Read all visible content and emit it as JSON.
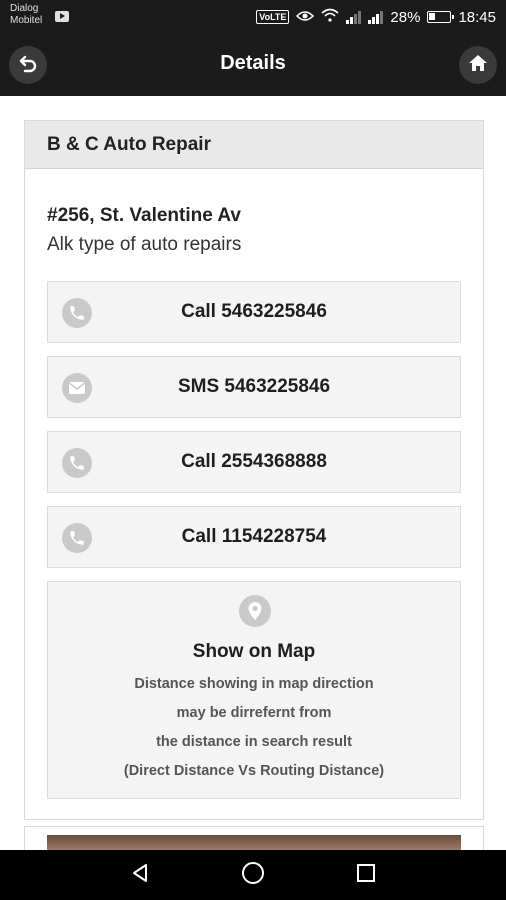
{
  "status_bar": {
    "carrier_line1": "Dialog",
    "carrier_line2": "Mobitel",
    "network_badge": "VoLTE",
    "battery": "28%",
    "time": "18:45"
  },
  "app_bar": {
    "title": "Details",
    "back_icon": "back-arrow-icon",
    "home_icon": "home-icon"
  },
  "business": {
    "name": "B & C Auto Repair",
    "address": "#256, St. Valentine Av",
    "description": "Alk type of auto repairs"
  },
  "actions": [
    {
      "icon": "phone-icon",
      "label": "Call 5463225846"
    },
    {
      "icon": "email-icon",
      "label": "SMS 5463225846"
    },
    {
      "icon": "phone-icon",
      "label": "Call 2554368888"
    },
    {
      "icon": "phone-icon",
      "label": "Call 1154228754"
    }
  ],
  "map": {
    "icon": "map-pin-icon",
    "title": "Show on Map",
    "note_line1": "Distance showing in map direction",
    "note_line2": "may be dirrefernt from",
    "note_line3": "the distance in search result",
    "note_line4": "(Direct Distance Vs Routing Distance)"
  },
  "nav_bar": {
    "back": "nav-back-icon",
    "home": "nav-home-icon",
    "recents": "nav-recents-icon"
  },
  "colors": {
    "app_bar": "#1b1b1b",
    "card_header": "#e9e9e9",
    "button_bg": "#f4f4f4",
    "icon_gray": "#c9c9c9"
  }
}
